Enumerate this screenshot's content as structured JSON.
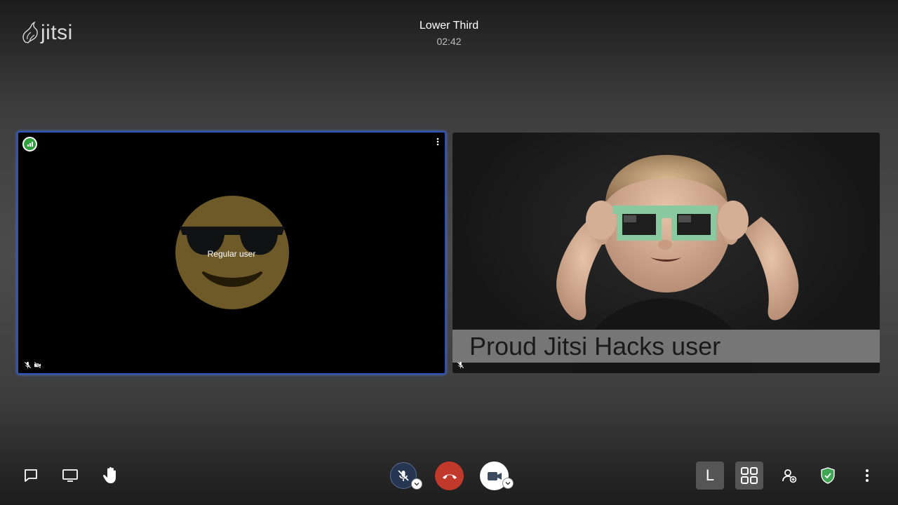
{
  "app": {
    "logo_text": "jitsi"
  },
  "header": {
    "title": "Lower Third",
    "timer": "02:42"
  },
  "participants": {
    "local": {
      "display_name": "Regular user"
    },
    "remote": {
      "lower_third": "Proud Jitsi Hacks user"
    }
  },
  "toolbar": {
    "left": [
      "chat-icon",
      "screen-share-icon",
      "raise-hand-icon"
    ],
    "center": [
      "microphone-muted-icon",
      "hangup-icon",
      "camera-icon"
    ],
    "right": {
      "avatar_letter": "L",
      "items": [
        "tile-view-icon",
        "invite-icon",
        "security-shield-icon",
        "more-options-icon"
      ]
    }
  },
  "colors": {
    "active_tile_border": "#2d55b5",
    "connection_good": "#31a13d",
    "hangup": "#c0392b",
    "mic_muted_bg": "#253552",
    "shield": "#3fa654"
  }
}
